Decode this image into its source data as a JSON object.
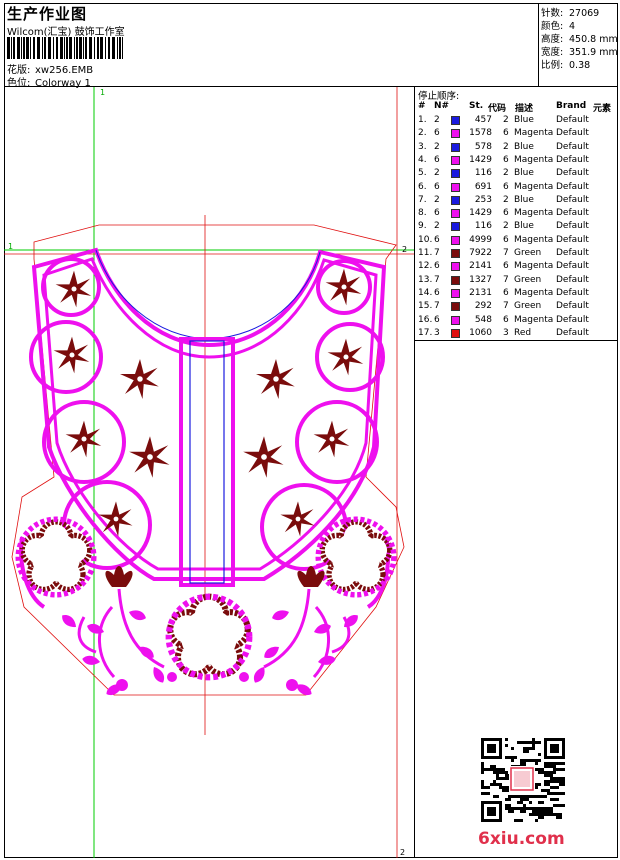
{
  "header": {
    "title": "生产作业图",
    "company": "Wilcom(汇宝) 鼓饰工作室",
    "design_label": "花版:",
    "design_value": "xw256.EMB",
    "colorway_label": "色位:",
    "colorway_value": "Colorway 1"
  },
  "stats": [
    {
      "label": "针数:",
      "value": "27069"
    },
    {
      "label": "颜色:",
      "value": "4"
    },
    {
      "label": "高度:",
      "value": "450.8 mm"
    },
    {
      "label": "宽度:",
      "value": "351.9 mm"
    },
    {
      "label": "比例:",
      "value": "0.38"
    }
  ],
  "canvas": {
    "marker_1_top": "1",
    "marker_1_left": "1",
    "marker_2_right": "2",
    "marker_2_bottom": "2"
  },
  "sequence": {
    "title": "停止顺序:",
    "headers": {
      "no": "#",
      "col": "N#",
      "st": "St.",
      "code": "代码",
      "desc": "描述",
      "brand": "Brand",
      "element": "元素"
    },
    "rows": [
      {
        "no": "1.",
        "col": "2",
        "color": "#1a1adf",
        "st": "457",
        "code": "2",
        "desc": "Blue",
        "brand": "Default"
      },
      {
        "no": "2.",
        "col": "6",
        "color": "#ee10ee",
        "st": "1578",
        "code": "6",
        "desc": "Magenta",
        "brand": "Default"
      },
      {
        "no": "3.",
        "col": "2",
        "color": "#1a1adf",
        "st": "578",
        "code": "2",
        "desc": "Blue",
        "brand": "Default"
      },
      {
        "no": "4.",
        "col": "6",
        "color": "#ee10ee",
        "st": "1429",
        "code": "6",
        "desc": "Magenta",
        "brand": "Default"
      },
      {
        "no": "5.",
        "col": "2",
        "color": "#1a1adf",
        "st": "116",
        "code": "2",
        "desc": "Blue",
        "brand": "Default"
      },
      {
        "no": "6.",
        "col": "6",
        "color": "#ee10ee",
        "st": "691",
        "code": "6",
        "desc": "Magenta",
        "brand": "Default"
      },
      {
        "no": "7.",
        "col": "2",
        "color": "#1a1adf",
        "st": "253",
        "code": "2",
        "desc": "Blue",
        "brand": "Default"
      },
      {
        "no": "8.",
        "col": "6",
        "color": "#ee10ee",
        "st": "1429",
        "code": "6",
        "desc": "Magenta",
        "brand": "Default"
      },
      {
        "no": "9.",
        "col": "2",
        "color": "#1a1adf",
        "st": "116",
        "code": "2",
        "desc": "Blue",
        "brand": "Default"
      },
      {
        "no": "10.",
        "col": "6",
        "color": "#ee10ee",
        "st": "4999",
        "code": "6",
        "desc": "Magenta",
        "brand": "Default"
      },
      {
        "no": "11.",
        "col": "7",
        "color": "#7a0c0c",
        "st": "7922",
        "code": "7",
        "desc": "Green",
        "brand": "Default"
      },
      {
        "no": "12.",
        "col": "6",
        "color": "#ee10ee",
        "st": "2141",
        "code": "6",
        "desc": "Magenta",
        "brand": "Default"
      },
      {
        "no": "13.",
        "col": "7",
        "color": "#7a0c0c",
        "st": "1327",
        "code": "7",
        "desc": "Green",
        "brand": "Default"
      },
      {
        "no": "14.",
        "col": "6",
        "color": "#ee10ee",
        "st": "2131",
        "code": "6",
        "desc": "Magenta",
        "brand": "Default"
      },
      {
        "no": "15.",
        "col": "7",
        "color": "#7a0c0c",
        "st": "292",
        "code": "7",
        "desc": "Green",
        "brand": "Default"
      },
      {
        "no": "16.",
        "col": "6",
        "color": "#ee10ee",
        "st": "548",
        "code": "6",
        "desc": "Magenta",
        "brand": "Default"
      },
      {
        "no": "17.",
        "col": "3",
        "color": "#e01010",
        "st": "1060",
        "code": "3",
        "desc": "Red",
        "brand": "Default"
      }
    ]
  },
  "watermark": "6xiu.com",
  "colors": {
    "magenta": "#ee10ee",
    "maroon": "#7a0c0c",
    "blue": "#1a1adf",
    "guide_green": "#00cc00",
    "guide_red": "#e01010"
  }
}
